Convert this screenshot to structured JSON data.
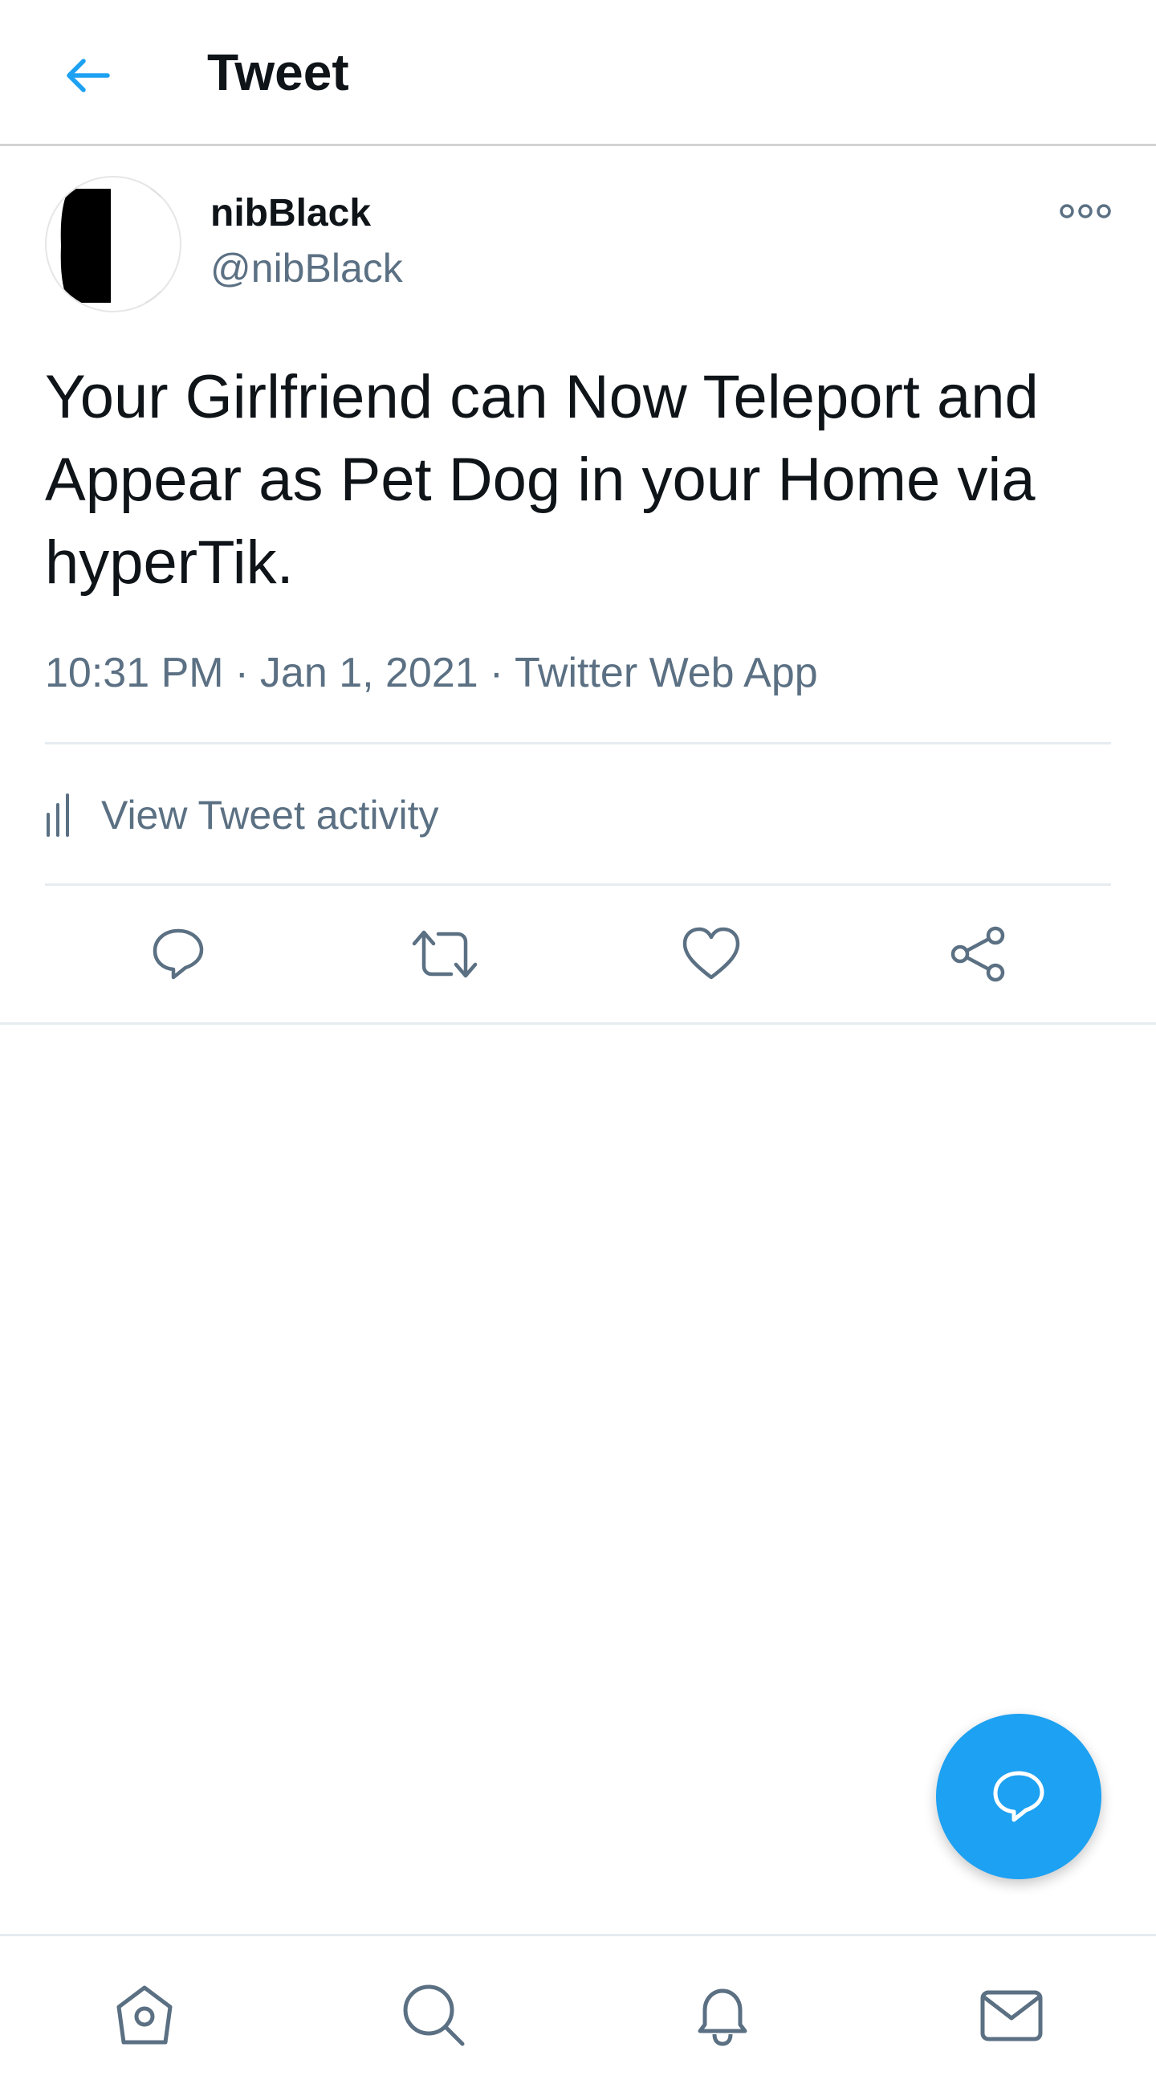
{
  "header": {
    "title": "Tweet",
    "back_icon": "arrow-left-icon"
  },
  "colors": {
    "accent": "#1da1f2",
    "text_primary": "#0f1419",
    "text_secondary": "#5b7083",
    "divider": "#e6ecf0"
  },
  "tweet": {
    "author": {
      "display_name": "nibBlack",
      "handle": "@nibBlack"
    },
    "text": "Your Girlfriend can Now Teleport and Appear as Pet Dog in your Home via hyperTik.",
    "time": "10:31 PM",
    "date": "Jan 1, 2021",
    "source": "Twitter Web App",
    "separator": "·"
  },
  "activity": {
    "label": "View Tweet activity",
    "icon": "analytics-icon"
  },
  "actions": [
    {
      "name": "reply",
      "icon": "reply-icon"
    },
    {
      "name": "retweet",
      "icon": "retweet-icon"
    },
    {
      "name": "like",
      "icon": "heart-icon"
    },
    {
      "name": "share",
      "icon": "share-icon"
    }
  ],
  "fab": {
    "icon": "compose-reply-icon"
  },
  "bottom_nav": [
    {
      "name": "home",
      "icon": "home-icon"
    },
    {
      "name": "search",
      "icon": "search-icon"
    },
    {
      "name": "notifications",
      "icon": "bell-icon"
    },
    {
      "name": "messages",
      "icon": "mail-icon"
    }
  ]
}
